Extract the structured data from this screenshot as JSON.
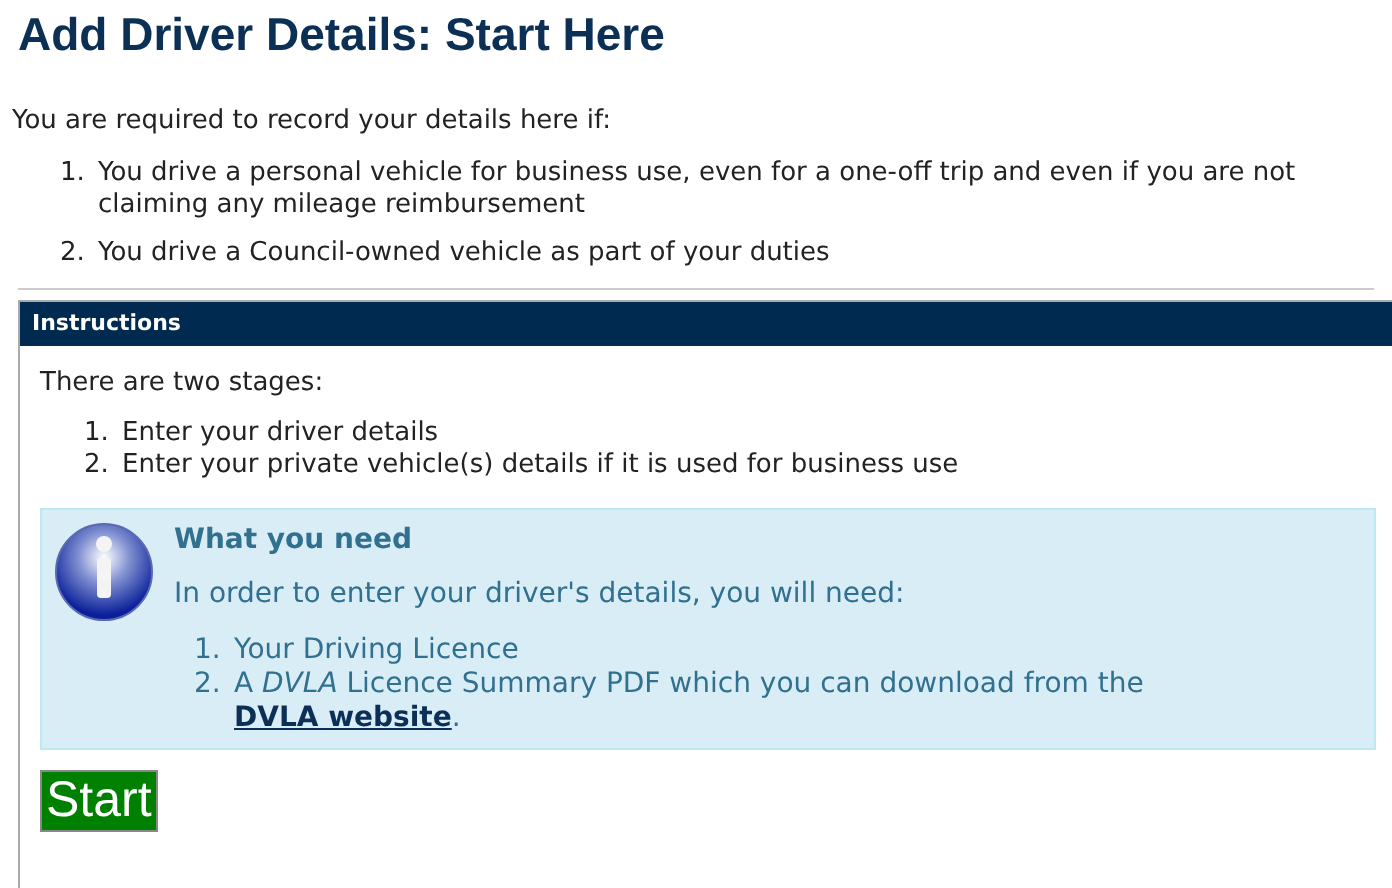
{
  "title": "Add Driver Details: Start Here",
  "intro": "You are required to record your details here if:",
  "requirements": [
    {
      "number": "1.",
      "text": "You drive a personal vehicle for business use, even for a one-off trip and even if you are not claiming any mileage reimbursement"
    },
    {
      "number": "2.",
      "text": "You drive a Council-owned vehicle as part of your duties"
    }
  ],
  "instructions": {
    "header": "Instructions",
    "lead": "There are two stages:",
    "stages": [
      {
        "number": "1.",
        "text": "Enter your driver details"
      },
      {
        "number": "2.",
        "text": "Enter your private vehicle(s) details if it is used for business use"
      }
    ],
    "info": {
      "heading": "What you need",
      "text": "In order to enter your driver's details, you will need:",
      "items": [
        {
          "number": "1.",
          "text": "Your Driving Licence"
        },
        {
          "number": "2.",
          "text": "A *DVLA* Licence Summary PDF which you can download from the",
          "link": "DVLA website",
          "after": "."
        }
      ]
    },
    "button": "Start"
  }
}
